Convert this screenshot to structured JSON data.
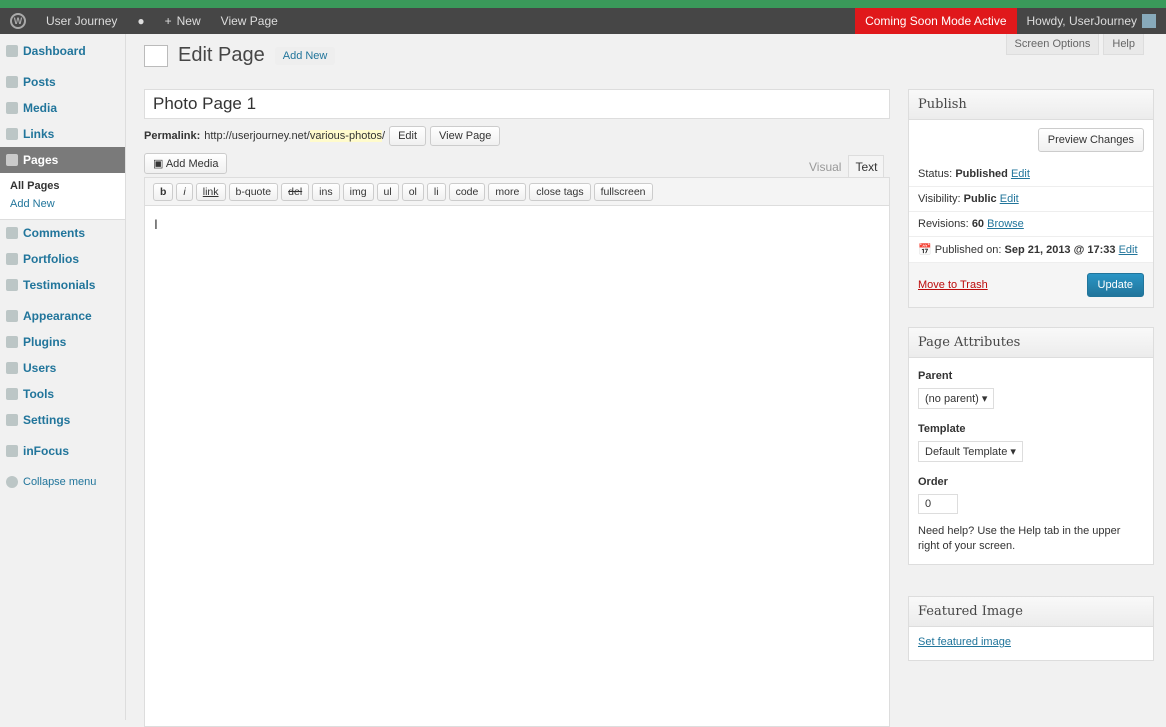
{
  "adminbar": {
    "site": "User Journey",
    "new": "New",
    "view_page": "View Page",
    "coming_soon": "Coming Soon Mode Active",
    "howdy": "Howdy, UserJourney"
  },
  "sidebar": {
    "items": [
      "Dashboard",
      "Posts",
      "Media",
      "Links",
      "Pages",
      "Comments",
      "Portfolios",
      "Testimonials",
      "Appearance",
      "Plugins",
      "Users",
      "Tools",
      "Settings",
      "inFocus"
    ],
    "sub": [
      "All Pages",
      "Add New"
    ],
    "collapse": "Collapse menu"
  },
  "header": {
    "title": "Edit Page",
    "add_new": "Add New",
    "screen_options": "Screen Options",
    "help": "Help"
  },
  "editor": {
    "title": "Photo Page 1",
    "permalink_label": "Permalink:",
    "permalink_base": "http://userjourney.net/",
    "permalink_slug": "various-photos",
    "permalink_end": "/",
    "edit": "Edit",
    "view_page": "View Page",
    "add_media": "Add Media",
    "tab_visual": "Visual",
    "tab_text": "Text",
    "quicktags": [
      "b",
      "i",
      "link",
      "b-quote",
      "del",
      "ins",
      "img",
      "ul",
      "ol",
      "li",
      "code",
      "more",
      "close tags",
      "fullscreen"
    ]
  },
  "publish": {
    "title": "Publish",
    "preview": "Preview Changes",
    "status_label": "Status:",
    "status": "Published",
    "visibility_label": "Visibility:",
    "visibility": "Public",
    "revisions_label": "Revisions:",
    "revisions": "60",
    "browse": "Browse",
    "published_on_label": "Published on:",
    "published_on": "Sep 21, 2013 @ 17:33",
    "edit": "Edit",
    "trash": "Move to Trash",
    "update": "Update"
  },
  "attributes": {
    "title": "Page Attributes",
    "parent_label": "Parent",
    "parent": "(no parent)",
    "template_label": "Template",
    "template": "Default Template",
    "order_label": "Order",
    "order": "0",
    "help": "Need help? Use the Help tab in the upper right of your screen."
  },
  "featured": {
    "title": "Featured Image",
    "set": "Set featured image"
  }
}
